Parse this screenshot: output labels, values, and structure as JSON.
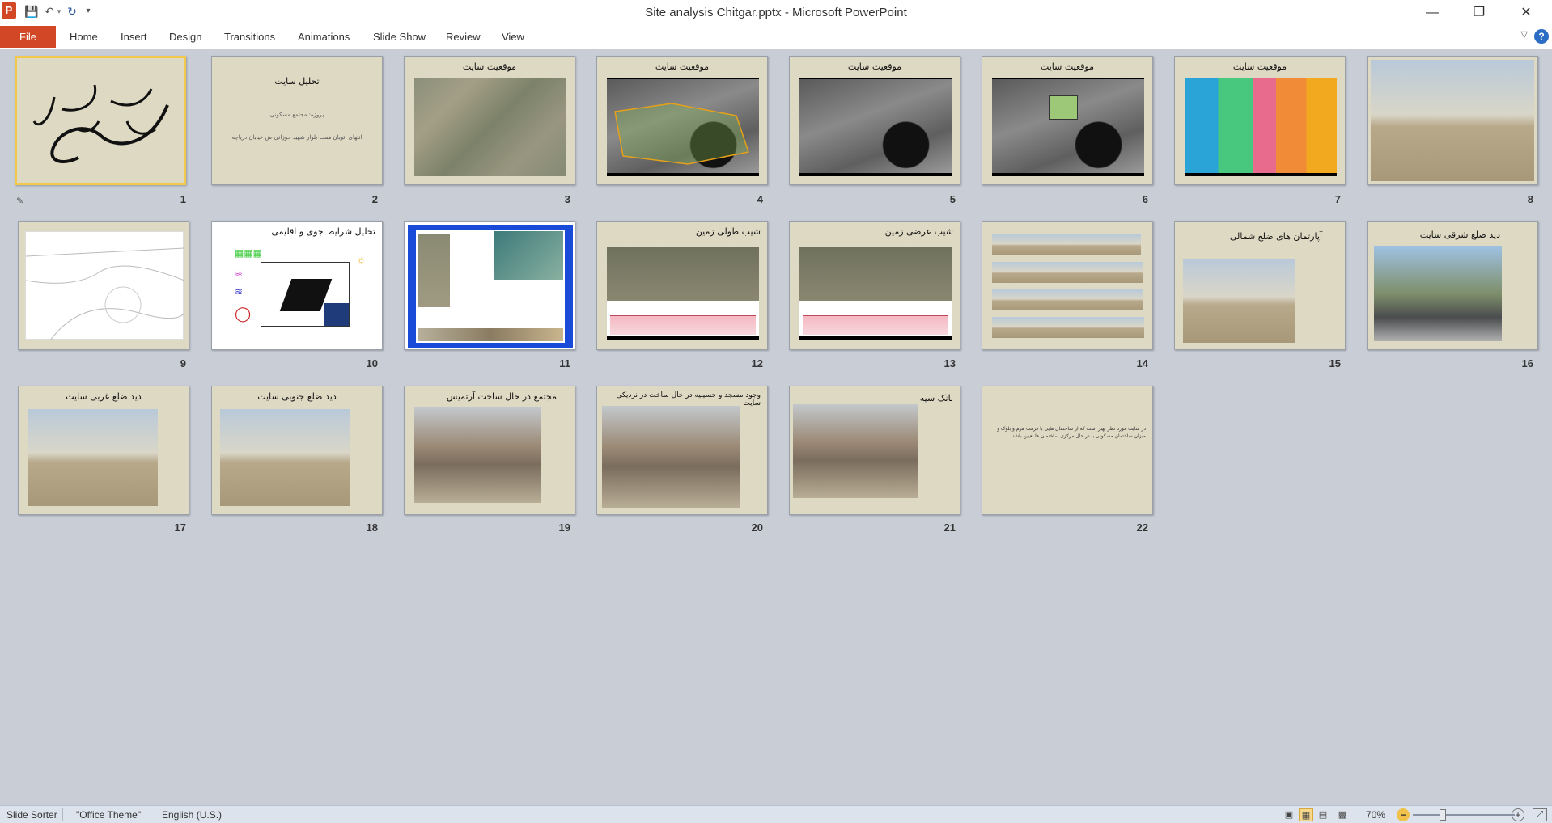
{
  "window": {
    "title": "Site analysis Chitgar.pptx  -  Microsoft PowerPoint",
    "app_icon": "P",
    "qat": [
      "save-icon",
      "undo-icon",
      "redo-icon",
      "customize-icon"
    ],
    "controls": [
      "minimize-icon",
      "restore-icon",
      "close-icon"
    ]
  },
  "ribbon": {
    "file": "File",
    "tabs": [
      "Home",
      "Insert",
      "Design",
      "Transitions",
      "Animations",
      "Slide Show",
      "Review",
      "View"
    ],
    "accent": "#d24726"
  },
  "slides": [
    {
      "num": "1",
      "title": "",
      "kind": "calligraphy",
      "selected": true
    },
    {
      "num": "2",
      "title": "تحلیل سایت",
      "body1": "پروژه: مجتمع مسکونی",
      "body2": "انتهای اتوبان همت-بلوار شهید حوزانی-ش خیابان دریاچه",
      "kind": "text"
    },
    {
      "num": "3",
      "title": "موقعیت سایت",
      "kind": "map-aerial"
    },
    {
      "num": "4",
      "title": "موقعیت سایت",
      "kind": "map-gray"
    },
    {
      "num": "5",
      "title": "موقعیت سایت",
      "kind": "map-gray"
    },
    {
      "num": "6",
      "title": "موقعیت سایت",
      "kind": "map-gray"
    },
    {
      "num": "7",
      "title": "موقعیت سایت",
      "kind": "map-zoned"
    },
    {
      "num": "8",
      "title": "",
      "kind": "photo-full"
    },
    {
      "num": "9",
      "title": "",
      "kind": "line-drawing"
    },
    {
      "num": "10",
      "title": "تحلیل شرایط جوی و اقلیمی",
      "kind": "climate"
    },
    {
      "num": "11",
      "title": "",
      "kind": "blue-panel"
    },
    {
      "num": "12",
      "title": "شیب طولی زمین",
      "kind": "terrain"
    },
    {
      "num": "13",
      "title": "شیب عرضی زمین",
      "kind": "terrain"
    },
    {
      "num": "14",
      "title": "",
      "kind": "panorama"
    },
    {
      "num": "15",
      "title": "آپارتمان های ضلع شمالی",
      "kind": "photo"
    },
    {
      "num": "16",
      "title": "دید ضلع شرقی سایت",
      "kind": "photo-street"
    },
    {
      "num": "17",
      "title": "دید ضلع غربی سایت",
      "kind": "photo"
    },
    {
      "num": "18",
      "title": "دید ضلع جنوبی سایت",
      "kind": "photo"
    },
    {
      "num": "19",
      "title": "مجتمع در حال ساخت آرتمیس",
      "kind": "photo-bldg"
    },
    {
      "num": "20",
      "title": "وجود مسجد و حسینیه در حال ساخت در نزدیکی سایت",
      "kind": "photo-bldg"
    },
    {
      "num": "21",
      "title": "بانک سپه",
      "kind": "photo-bldg-left"
    },
    {
      "num": "22",
      "title": "",
      "body1": "در سایت مورد نظر بهتر است که از ساختمان هایی با فرمت هرم و بلوک و میزان ساختمان مسکونی با در حال مرکزی ساختمان ها تعیین باشد",
      "kind": "textonly"
    }
  ],
  "slide_notes_icon": "transition-icon",
  "statusbar": {
    "view": "Slide Sorter",
    "theme": "\"Office Theme\"",
    "language": "English (U.S.)",
    "zoom": "70%",
    "zoom_fraction": 0.7
  }
}
